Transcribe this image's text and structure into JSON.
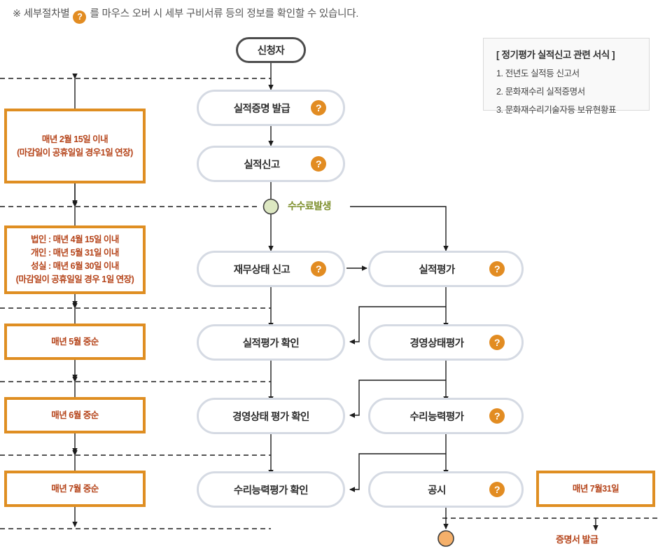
{
  "header": {
    "note_before": "※ 세부절차별",
    "help_icon": "question-mark-icon",
    "note_after": "를 마우스 오버 시 세부 구비서류 등의 정보를 확인할 수 있습니다."
  },
  "legend": {
    "title": "[ 정기평가 실적신고 관련 서식 ]",
    "items": [
      "1. 전년도 실적등 신고서",
      "2. 문화재수리 실적증명서",
      "3. 문화재수리기술자등 보유현황표"
    ]
  },
  "timeline_boxes": [
    {
      "id": "feb15",
      "lines": [
        "매년 2월 15일 이내",
        "(마감일이 공휴일일 경우1일 연장)"
      ]
    },
    {
      "id": "corp",
      "lines": [
        "법인 : 매년 4월 15일 이내",
        "개인 : 매년 5월 31일 이내",
        "성실 : 매년 6월 30일 이내",
        "(마감일이 공휴일일 경우 1일 연장)"
      ]
    },
    {
      "id": "may",
      "lines": [
        "매년 5월 중순"
      ]
    },
    {
      "id": "jun",
      "lines": [
        "매년 6월 중순"
      ]
    },
    {
      "id": "jul",
      "lines": [
        "매년 7월 중순"
      ]
    }
  ],
  "right_date_box": {
    "lines": [
      "매년 7월31일"
    ]
  },
  "nodes": {
    "applicant": {
      "label": "신청자",
      "help": false
    },
    "issue_cert": {
      "label": "실적증명 발급",
      "help": true
    },
    "report_perf": {
      "label": "실적신고",
      "help": true
    },
    "report_finance": {
      "label": "재무상태 신고",
      "help": true
    },
    "eval_perf": {
      "label": "실적평가",
      "help": true
    },
    "confirm_perf": {
      "label": "실적평가 확인",
      "help": false
    },
    "eval_mgmt": {
      "label": "경영상태평가",
      "help": true
    },
    "confirm_mgmt": {
      "label": "경영상태 평가 확인",
      "help": false
    },
    "eval_repair": {
      "label": "수리능력평가",
      "help": true
    },
    "confirm_repair": {
      "label": "수리능력평가 확인",
      "help": false
    },
    "publish": {
      "label": "공시",
      "help": true
    }
  },
  "markers": {
    "fee_label": "수수료발생",
    "fee_node": "fee-circle-node",
    "end_node": "end-circle-node",
    "cert_issue_label": "증명서 발급"
  },
  "colors": {
    "orange_border": "#df8e22",
    "orange_icon": "#e28c22",
    "date_text": "#b5441a",
    "node_border": "#d5dae3",
    "start_border": "#4d4d4d",
    "fee_green_text": "#7d8f2c",
    "fee_green_fill": "#dde8c2",
    "line": "#222222",
    "legend_bg": "#f9f9f9"
  }
}
